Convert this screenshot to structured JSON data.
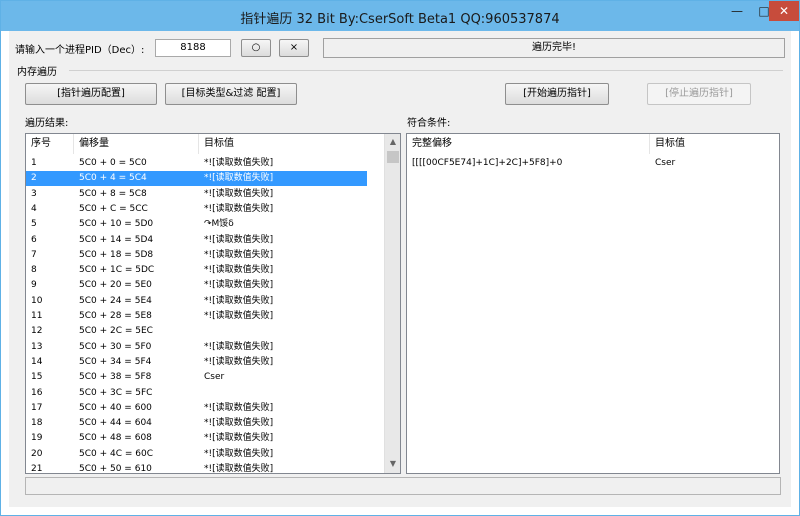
{
  "window": {
    "title": "指针遍历  32 Bit    By:CserSoft    Beta1  QQ:960537874",
    "minimize": "—",
    "maximize": "□",
    "close": "✕"
  },
  "pid": {
    "label": "请输入一个进程PID（Dec）:",
    "value": "8188",
    "btn_o": "○",
    "btn_x": "×",
    "status": "遍历完毕!"
  },
  "memory_group": {
    "label": "内存遍历",
    "config_btn": "[指针遍历配置]",
    "filter_btn": "[目标类型&过滤 配置]",
    "start_btn": "[开始遍历指针]",
    "stop_btn": "[停止遍历指针]"
  },
  "results": {
    "label": "遍历结果:",
    "headers": [
      "序号",
      "偏移量",
      "目标值"
    ],
    "rows": [
      [
        "1",
        "5C0 + 0 = 5C0",
        "*![读取数值失败]"
      ],
      [
        "2",
        "5C0 + 4 = 5C4",
        "*![读取数值失败]"
      ],
      [
        "3",
        "5C0 + 8 = 5C8",
        "*![读取数值失败]"
      ],
      [
        "4",
        "5C0 + C = 5CC",
        "*![读取数值失败]"
      ],
      [
        "5",
        "5C0 + 10 = 5D0",
        "↷M馁δ"
      ],
      [
        "6",
        "5C0 + 14 = 5D4",
        "*![读取数值失败]"
      ],
      [
        "7",
        "5C0 + 18 = 5D8",
        "*![读取数值失败]"
      ],
      [
        "8",
        "5C0 + 1C = 5DC",
        "*![读取数值失败]"
      ],
      [
        "9",
        "5C0 + 20 = 5E0",
        "*![读取数值失败]"
      ],
      [
        "10",
        "5C0 + 24 = 5E4",
        "*![读取数值失败]"
      ],
      [
        "11",
        "5C0 + 28 = 5E8",
        "*![读取数值失败]"
      ],
      [
        "12",
        "5C0 + 2C = 5EC",
        ""
      ],
      [
        "13",
        "5C0 + 30 = 5F0",
        "*![读取数值失败]"
      ],
      [
        "14",
        "5C0 + 34 = 5F4",
        "*![读取数值失败]"
      ],
      [
        "15",
        "5C0 + 38 = 5F8",
        "Cser"
      ],
      [
        "16",
        "5C0 + 3C = 5FC",
        ""
      ],
      [
        "17",
        "5C0 + 40 = 600",
        "*![读取数值失败]"
      ],
      [
        "18",
        "5C0 + 44 = 604",
        "*![读取数值失败]"
      ],
      [
        "19",
        "5C0 + 48 = 608",
        "*![读取数值失败]"
      ],
      [
        "20",
        "5C0 + 4C = 60C",
        "*![读取数值失败]"
      ],
      [
        "21",
        "5C0 + 50 = 610",
        "*![读取数值失败]"
      ]
    ],
    "selected_index": 1
  },
  "matches": {
    "label": "符合条件:",
    "headers": [
      "完整偏移",
      "目标值"
    ],
    "rows": [
      [
        "[[[[00CF5E74]+1C]+2C]+5F8]+0",
        "Cser"
      ]
    ]
  },
  "scroll": {
    "up": "▲",
    "down": "▼"
  },
  "colors": {
    "titlebar": "#6cb8ea",
    "close": "#c74c3c",
    "selection": "#3399ff"
  }
}
